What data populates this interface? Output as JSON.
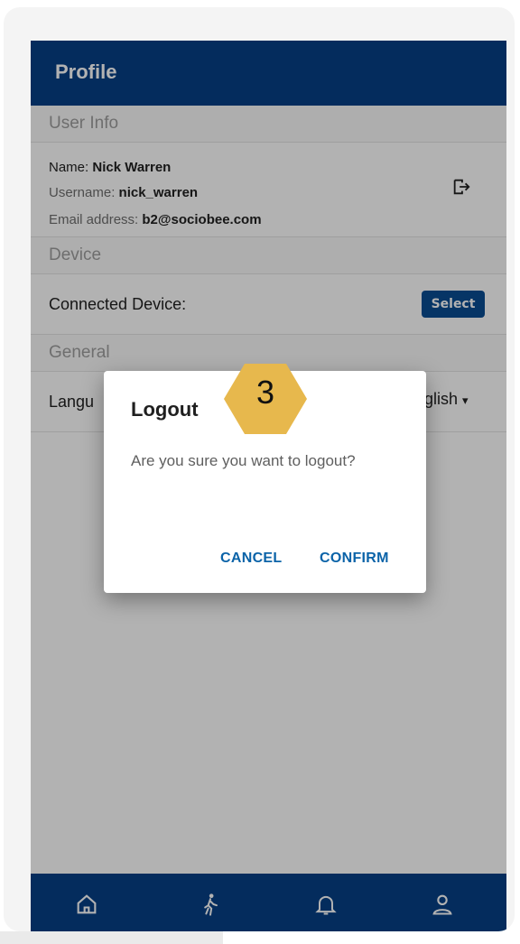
{
  "appbar": {
    "title": "Profile"
  },
  "sections": {
    "user_info": "User Info",
    "device": "Device",
    "general": "General"
  },
  "user": {
    "name_label": "Name:",
    "name_value": "Nick Warren",
    "username_label": "Username:",
    "username_value": "nick_warren",
    "email_label": "Email address:",
    "email_value": "b2@sociobee.com"
  },
  "device": {
    "label": "Connected Device:",
    "select_label": "Select"
  },
  "general": {
    "language_label": "Langu",
    "language_value": "glish"
  },
  "dialog": {
    "title": "Logout",
    "message": "Are you sure you want to logout?",
    "cancel": "CANCEL",
    "confirm": "CONFIRM"
  },
  "badge": {
    "number": "3",
    "color": "#e7b84d"
  },
  "nav": {
    "items": [
      "home-icon",
      "walk-icon",
      "bell-icon",
      "profile-icon"
    ]
  },
  "colors": {
    "primary": "#063f86",
    "accent_button": "#0a4c93",
    "dialog_button_text": "#0b63a8"
  }
}
